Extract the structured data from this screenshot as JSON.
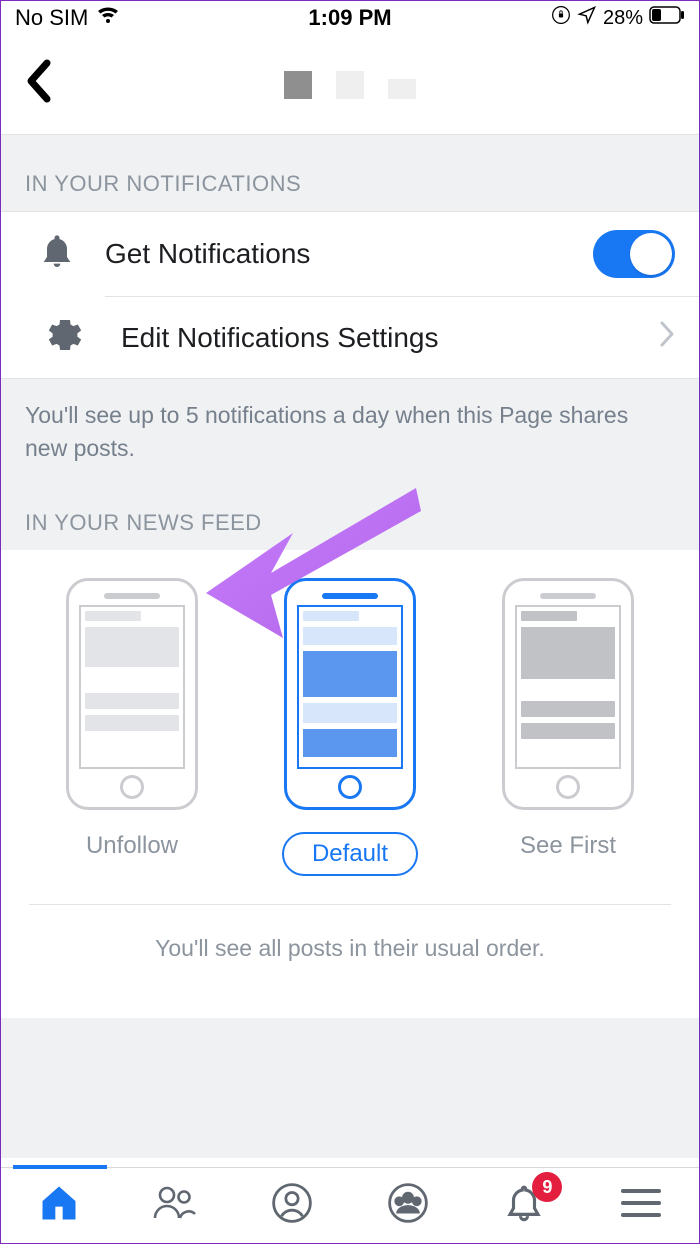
{
  "statusBar": {
    "carrier": "No SIM",
    "time": "1:09 PM",
    "batteryPercent": "28%"
  },
  "sections": {
    "notifications": {
      "header": "IN YOUR NOTIFICATIONS",
      "getNotifications": {
        "label": "Get Notifications",
        "on": true
      },
      "editSettings": {
        "label": "Edit Notifications Settings"
      },
      "hint": "You'll see up to 5 notifications a day when this Page shares new posts."
    },
    "newsfeed": {
      "header": "IN YOUR NEWS FEED",
      "options": {
        "unfollow": "Unfollow",
        "default": "Default",
        "seeFirst": "See First"
      },
      "hint": "You'll see all posts in their usual order."
    }
  },
  "tabs": {
    "badgeCount": "9"
  }
}
